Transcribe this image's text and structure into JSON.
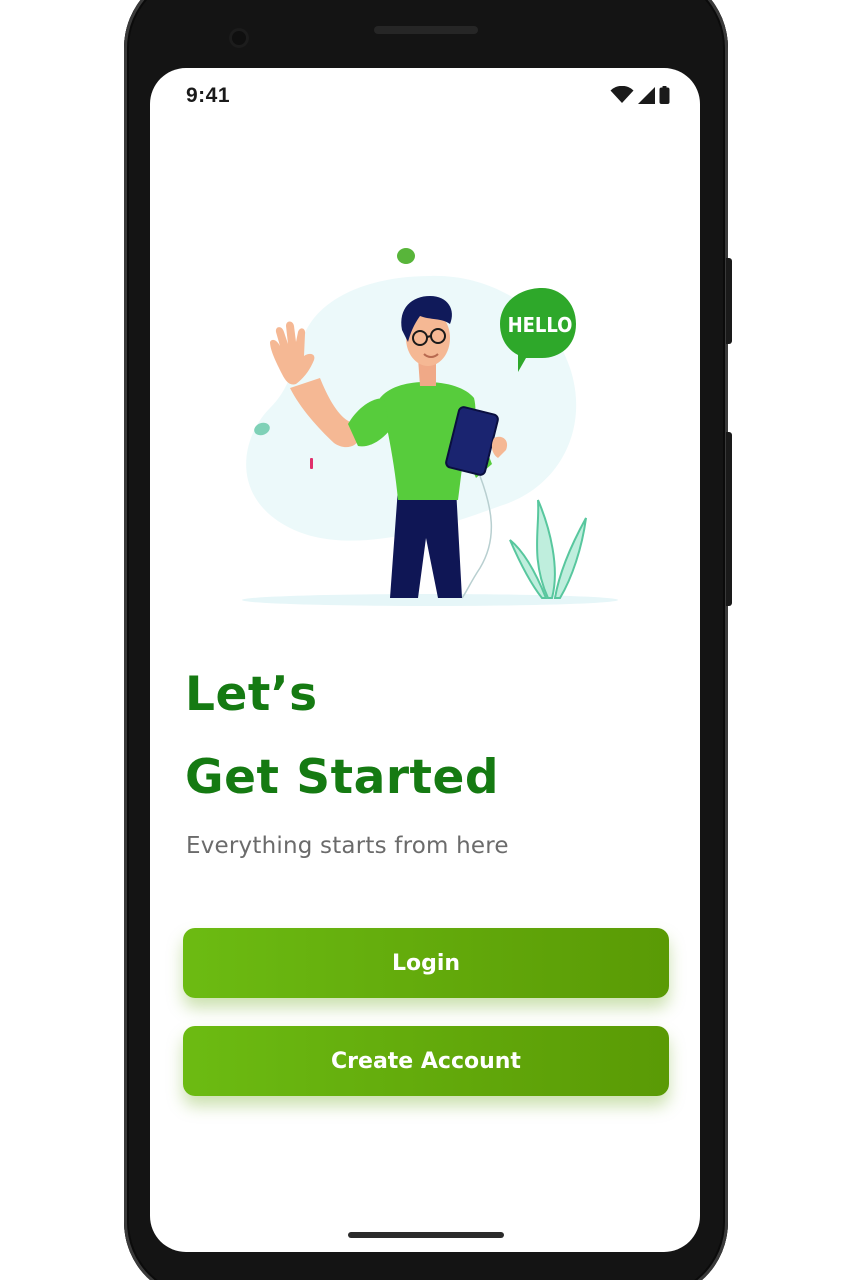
{
  "status_bar": {
    "time": "9:41",
    "icons": [
      "wifi-icon",
      "cellular-signal-icon",
      "battery-icon"
    ]
  },
  "illustration": {
    "name": "man-waving-with-tablet",
    "speech_bubble_text": "HELLO"
  },
  "headline": {
    "line1": "Let’s",
    "line2": "Get Started"
  },
  "subtitle": "Everything starts from here",
  "actions": {
    "login_label": "Login",
    "create_account_label": "Create Account"
  },
  "colors": {
    "brand_green": "#157a12",
    "button_gradient_start": "#6cbb12",
    "button_gradient_end": "#5a9a05",
    "subtitle_gray": "#6b6b6b"
  }
}
